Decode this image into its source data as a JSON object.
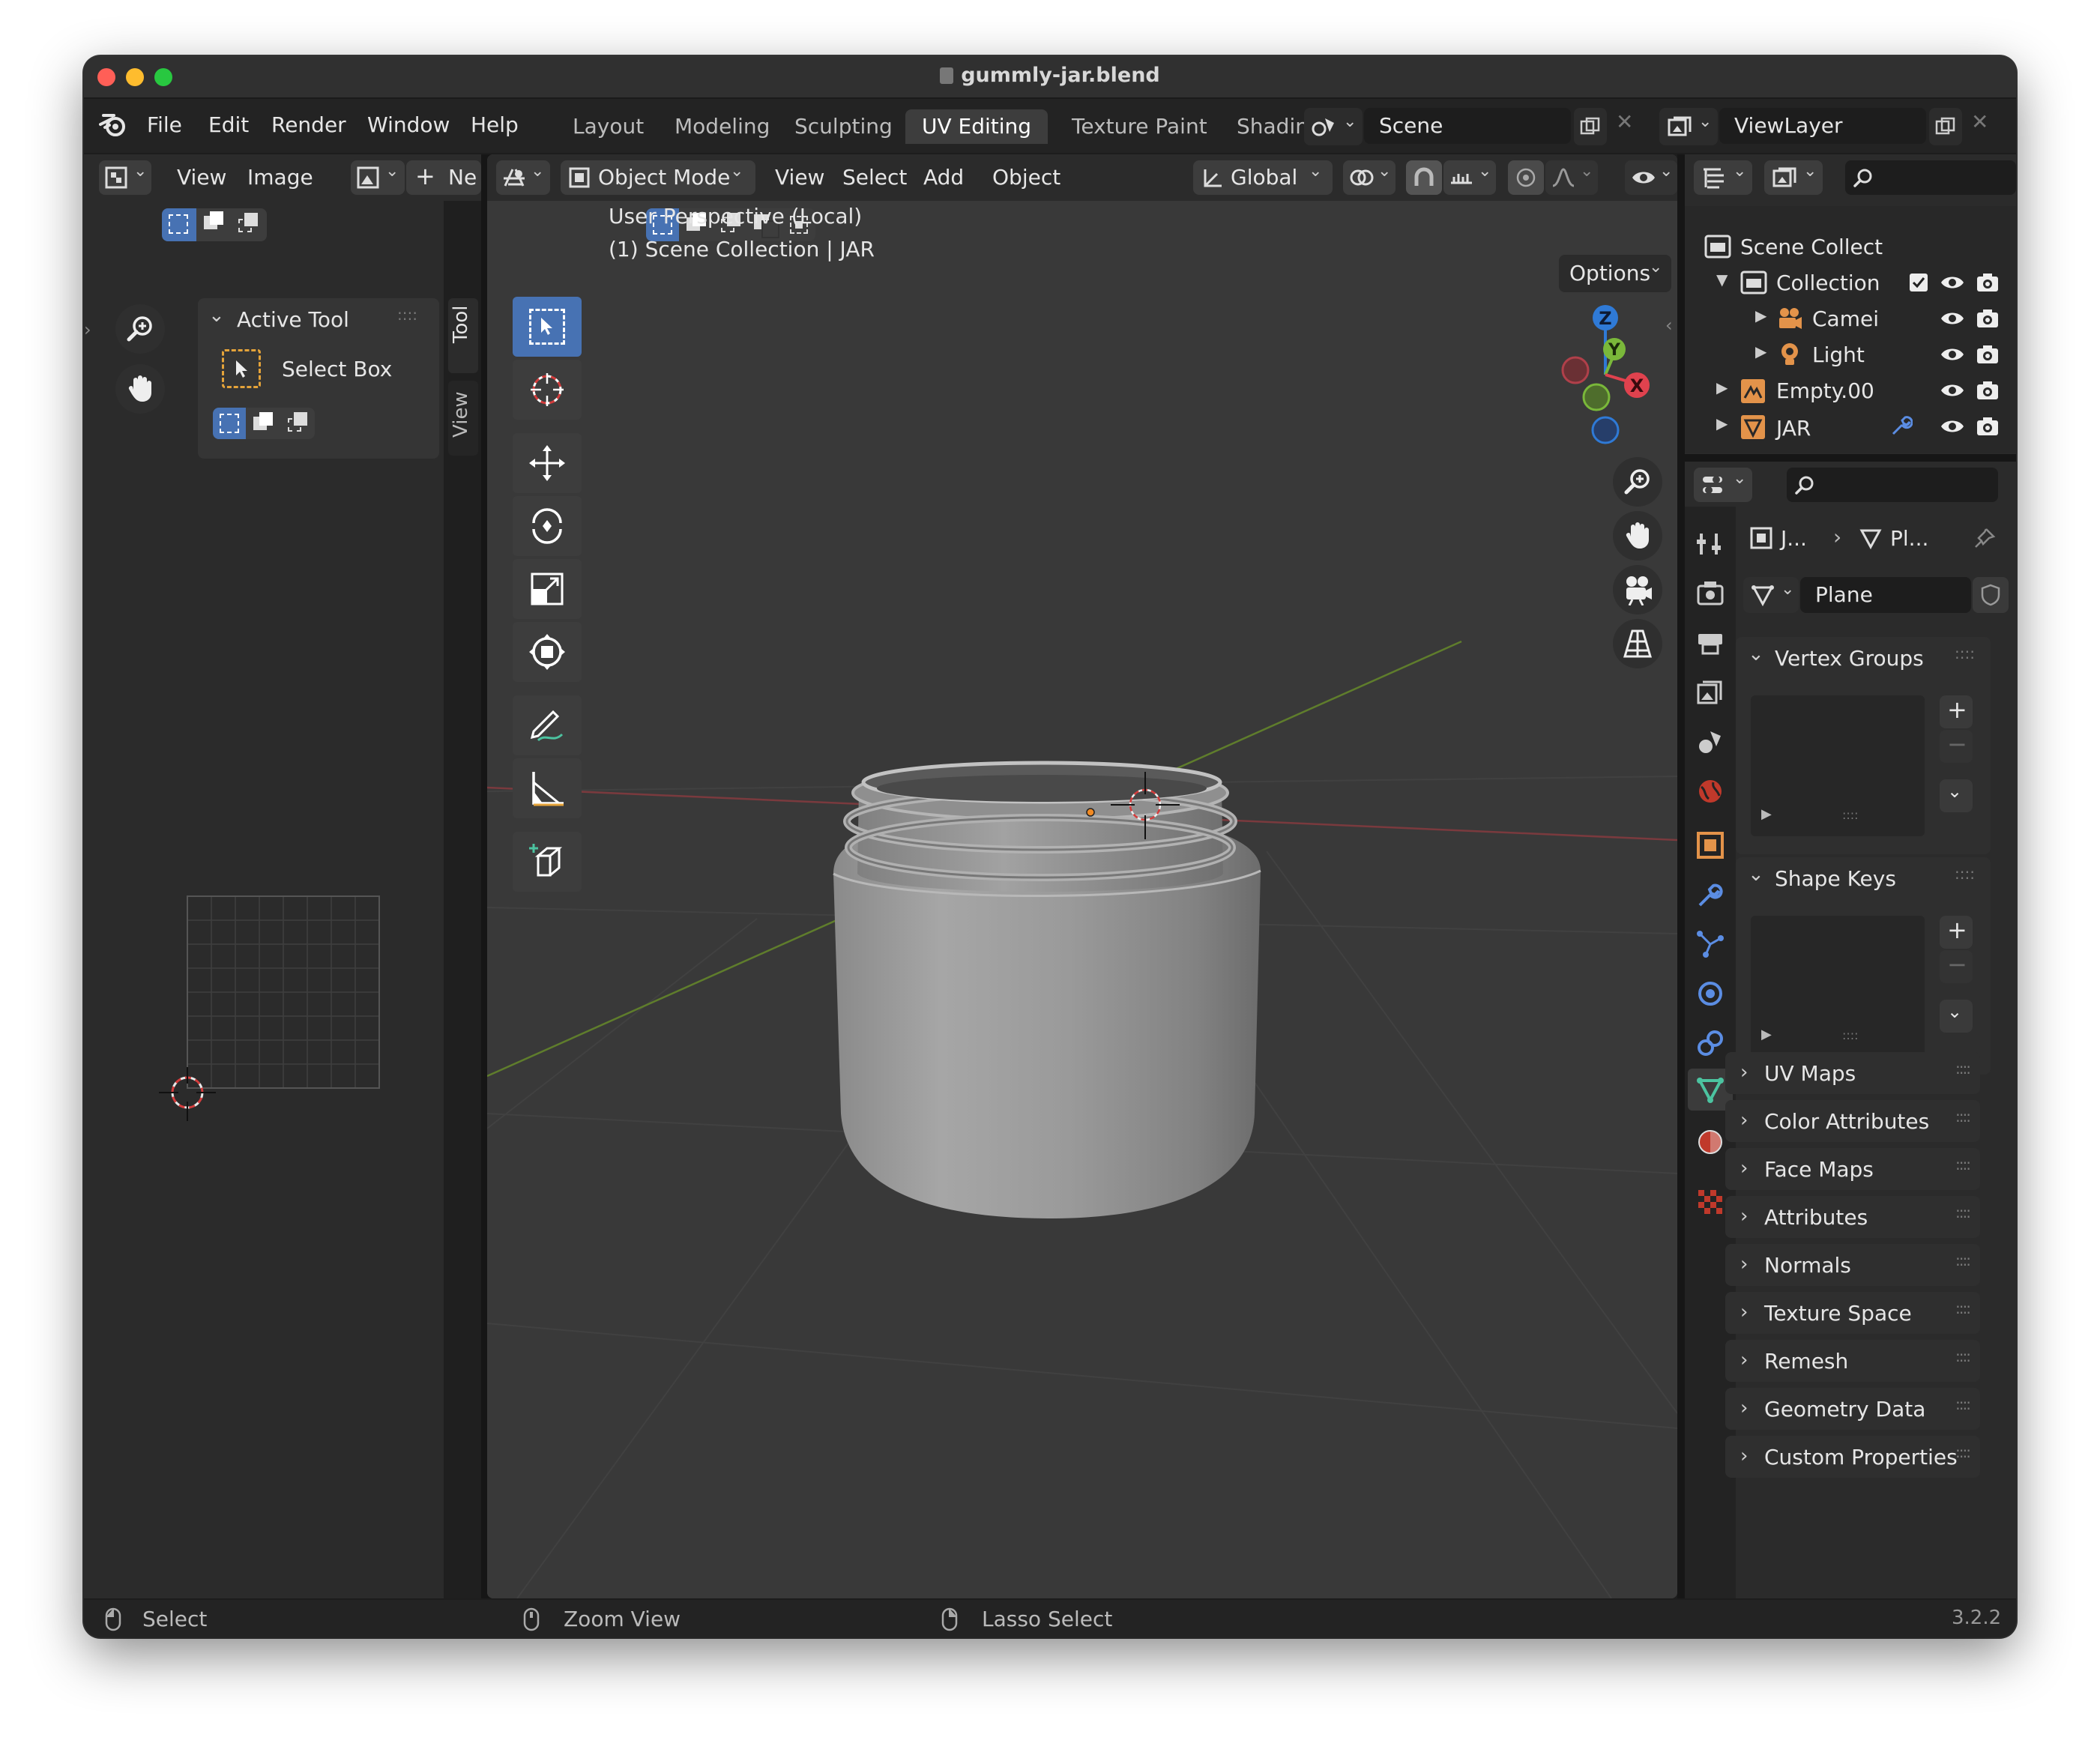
{
  "window": {
    "title": "gummly-jar.blend"
  },
  "menu": [
    "File",
    "Edit",
    "Render",
    "Window",
    "Help"
  ],
  "workspace_tabs": [
    "Layout",
    "Modeling",
    "Sculpting",
    "UV Editing",
    "Texture Paint",
    "Shading"
  ],
  "active_tab": "UV Editing",
  "scene": {
    "name": "Scene"
  },
  "view_layer": {
    "name": "ViewLayer"
  },
  "uv_editor": {
    "header": {
      "view": "View",
      "image": "Image",
      "new": "Ne"
    },
    "active_tool_panel": {
      "title": "Active Tool",
      "tool": "Select Box"
    },
    "tabs": [
      "Tool",
      "View"
    ]
  },
  "viewport": {
    "header": {
      "mode": "Object Mode",
      "view": "View",
      "select": "Select",
      "add": "Add",
      "object": "Object",
      "orientation": "Global",
      "options": "Options"
    },
    "overlay_text": [
      "User Perspective (Local)",
      "(1) Scene Collection | JAR"
    ],
    "gizmo": {
      "x": "X",
      "y": "Y",
      "z": "Z"
    }
  },
  "outliner": {
    "items": [
      {
        "name": "Scene Collect",
        "icon": "scene-collection-icon"
      },
      {
        "name": "Collection",
        "icon": "collection-icon"
      },
      {
        "name": "Camei",
        "icon": "camera-icon"
      },
      {
        "name": "Light",
        "icon": "light-icon"
      },
      {
        "name": "Empty.00:",
        "icon": "empty-icon"
      },
      {
        "name": "JAR",
        "icon": "mesh-icon"
      }
    ]
  },
  "properties": {
    "breadcrumb": {
      "object": "J...",
      "data": "Pl..."
    },
    "mesh_name": "Plane",
    "sections": {
      "vertex_groups": "Vertex Groups",
      "shape_keys": "Shape Keys",
      "uv_maps": "UV Maps",
      "color_attributes": "Color Attributes",
      "face_maps": "Face Maps",
      "attributes": "Attributes",
      "normals": "Normals",
      "texture_space": "Texture Space",
      "remesh": "Remesh",
      "geometry_data": "Geometry Data",
      "custom_properties": "Custom Properties"
    }
  },
  "status": {
    "left": "Select",
    "middle": "Zoom View",
    "right": "Lasso Select",
    "version": "3.2.2"
  },
  "colors": {
    "accent": "#4772b3",
    "axis_x": "#e0424e",
    "axis_y": "#7ab83a",
    "axis_z": "#2f7ad6",
    "bg": "#1d1d1d",
    "panel": "#303030",
    "viewport": "#393939"
  }
}
